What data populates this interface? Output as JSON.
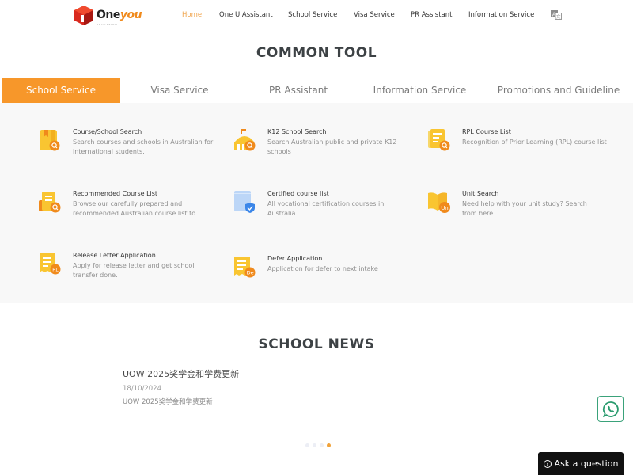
{
  "brand": {
    "name_part1": "One",
    "name_part2": "you",
    "tagline": "EDUCATION"
  },
  "nav": {
    "items": [
      {
        "label": "Home",
        "active": true
      },
      {
        "label": "One U Assistant",
        "active": false
      },
      {
        "label": "School Service",
        "active": false
      },
      {
        "label": "Visa Service",
        "active": false
      },
      {
        "label": "PR Assistant",
        "active": false
      },
      {
        "label": "Information Service",
        "active": false
      }
    ],
    "language_icon": "translate-icon"
  },
  "common_tool": {
    "title": "COMMON TOOL",
    "tabs": [
      {
        "label": "School Service",
        "active": true
      },
      {
        "label": "Visa Service",
        "active": false
      },
      {
        "label": "PR Assistant",
        "active": false
      },
      {
        "label": "Information Service",
        "active": false
      },
      {
        "label": "Promotions and Guideline",
        "active": false
      }
    ],
    "cards": [
      {
        "title": "Course/School Search",
        "desc": "Search courses and schools in Australian for international students.",
        "icon": "book-search-icon"
      },
      {
        "title": "K12 School Search",
        "desc": "Search Australian public and private K12 schools",
        "icon": "school-search-icon"
      },
      {
        "title": "RPL Course List",
        "desc": "Recognition of Prior Learning (RPL) course list",
        "icon": "document-search-icon"
      },
      {
        "title": "Recommended Course List",
        "desc": "Browse our carefully prepared and recommended Australian course list to...",
        "icon": "list-search-icon"
      },
      {
        "title": "Certified course list",
        "desc": "All vocational certification courses in Australia",
        "icon": "certified-shield-icon"
      },
      {
        "title": "Unit Search",
        "desc": "Need help with your unit study? Search from here.",
        "icon": "open-book-unit-icon",
        "badge": "Un"
      },
      {
        "title": "Release Letter Application",
        "desc": "Apply for release letter and get school transfer done.",
        "icon": "release-letter-icon",
        "badge": "RL"
      },
      {
        "title": "Defer Application",
        "desc": "Application for defer to next intake",
        "icon": "defer-application-icon",
        "badge": "De"
      }
    ]
  },
  "school_news": {
    "title": "SCHOOL NEWS",
    "items": [
      {
        "title": "UOW 2025奖学金和学费更新",
        "date": "18/10/2024",
        "summary": "UOW 2025奖学金和学费更新"
      }
    ],
    "carousel": {
      "count": 4,
      "active_index": 3
    }
  },
  "floating": {
    "whatsapp_icon": "whatsapp-icon",
    "ask_label": "Ask a question",
    "ask_icon": "question-circle-icon"
  },
  "colors": {
    "accent": "#f7972a",
    "nav_active": "#f0a34a",
    "whatsapp": "#3aa27a"
  }
}
